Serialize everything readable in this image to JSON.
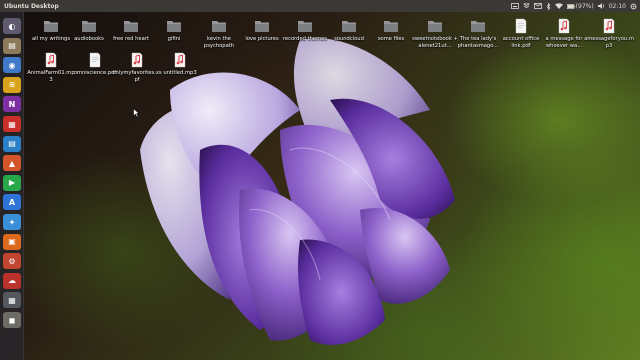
{
  "top_panel": {
    "title": "Ubuntu Desktop",
    "battery": "(97%)",
    "time": "02:10"
  },
  "launcher": {
    "items": [
      {
        "name": "dash-home",
        "glyph": "◐",
        "color": "#5f5a70"
      },
      {
        "name": "files",
        "glyph": "▤",
        "color": "#8c7a5a"
      },
      {
        "name": "chromium",
        "glyph": "◉",
        "color": "#3f79c8"
      },
      {
        "name": "lens",
        "glyph": "≋",
        "color": "#d9a21b"
      },
      {
        "name": "onenote",
        "glyph": "N",
        "color": "#7b2fa0"
      },
      {
        "name": "calendar",
        "glyph": "▦",
        "color": "#c9302c"
      },
      {
        "name": "libreoffice-writer",
        "glyph": "▤",
        "color": "#2b7fc4"
      },
      {
        "name": "libreoffice-impress",
        "glyph": "▲",
        "color": "#d4552a"
      },
      {
        "name": "play-store",
        "glyph": "▶",
        "color": "#27a84a"
      },
      {
        "name": "app-store",
        "glyph": "A",
        "color": "#2e74d6"
      },
      {
        "name": "feather-app",
        "glyph": "✦",
        "color": "#3a8fd8"
      },
      {
        "name": "software-center",
        "glyph": "▣",
        "color": "#dd6a1c"
      },
      {
        "name": "settings",
        "glyph": "⚙",
        "color": "#c2452f"
      },
      {
        "name": "ubuntu-one",
        "glyph": "☁",
        "color": "#b9322b"
      },
      {
        "name": "calculator",
        "glyph": "▦",
        "color": "#55595f"
      },
      {
        "name": "trash",
        "glyph": "◼",
        "color": "#6d6b66"
      }
    ]
  },
  "desktop": {
    "row1": [
      {
        "label": "all my writings",
        "type": "folder"
      },
      {
        "label": "audiobooks",
        "type": "folder"
      },
      {
        "label": "free red heart",
        "type": "folder"
      },
      {
        "label": "gifini",
        "type": "folder"
      },
      {
        "label": "kevin the psychopath",
        "type": "folder"
      },
      {
        "label": "love pictures",
        "type": "folder"
      },
      {
        "label": "recorded themes",
        "type": "folder"
      },
      {
        "label": "soundcloud",
        "type": "folder"
      },
      {
        "label": "some files",
        "type": "folder"
      },
      {
        "label": "sweetnotebook + alenet21ut...",
        "type": "folder"
      },
      {
        "label": "The tea lady's phantasmago...",
        "type": "folder"
      },
      {
        "label": "account office link.pdf",
        "type": "doc"
      },
      {
        "label": "a message for whoever wa...",
        "type": "audio"
      },
      {
        "label": "amessageforyou.mp3",
        "type": "audio"
      }
    ],
    "row2": [
      {
        "label": "AnimalFarm01.mp3",
        "type": "audio"
      },
      {
        "label": "omniscience.pdf",
        "type": "doc"
      },
      {
        "label": "onlymyfavorites.xspf",
        "type": "audio"
      },
      {
        "label": "untitled.mp3",
        "type": "audio"
      }
    ]
  },
  "colors": {
    "panel": "#3a3935",
    "folder": "#7d7f82",
    "folder_tab": "#95979a",
    "audio_note": "#d9434c"
  }
}
